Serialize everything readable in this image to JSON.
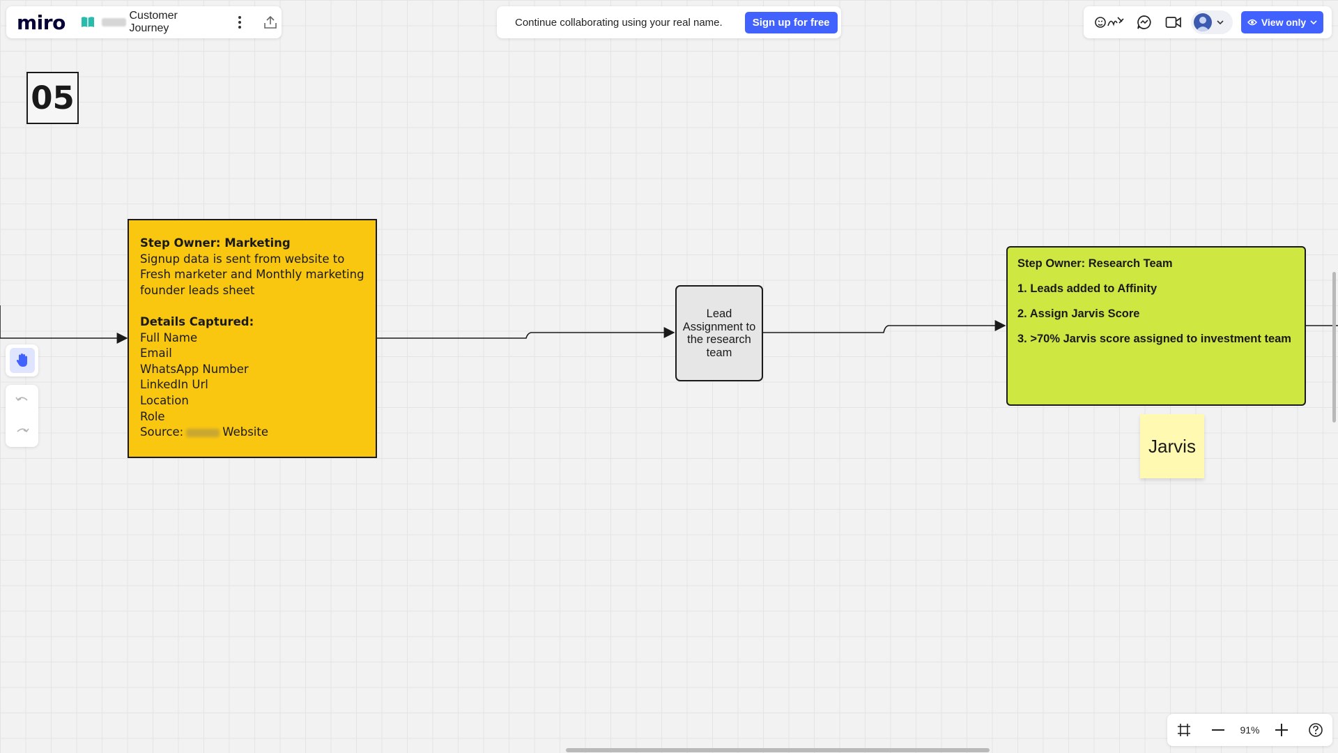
{
  "app": {
    "logo": "miro"
  },
  "board": {
    "title": "Customer Journey"
  },
  "banner": {
    "text": "Continue collaborating using your real name.",
    "signup_label": "Sign up for free"
  },
  "header_right": {
    "view_only_label": "View only"
  },
  "canvas": {
    "frame_number": "05",
    "marketing_card": {
      "owner": "Step Owner: Marketing",
      "description": "Signup data is  sent from website to Fresh marketer and Monthly marketing founder leads sheet",
      "details_heading": "Details Captured:",
      "details": [
        "Full Name",
        "Email",
        "WhatsApp Number",
        "LinkedIn Url",
        "Location",
        "Role"
      ],
      "source_prefix": "Source:",
      "source_suffix": "Website"
    },
    "lead_box": {
      "text": "Lead Assignment to the research team"
    },
    "research_card": {
      "owner": "Step Owner: Research Team",
      "items": [
        "1. Leads added to Affinity",
        "2. Assign Jarvis Score",
        "3. >70% Jarvis score assigned to investment team"
      ]
    },
    "sticky_note": {
      "text": "Jarvis"
    }
  },
  "zoom": {
    "level": "91%"
  },
  "icons": {
    "board": "book-icon",
    "more": "more-vertical-icon",
    "share": "upload-icon",
    "reactions": "reactions-icon",
    "comments": "comment-icon",
    "video": "video-icon",
    "avatar": "user-avatar-icon",
    "eye": "eye-icon",
    "hand": "hand-icon",
    "undo": "undo-icon",
    "redo": "redo-icon",
    "fit": "fit-screen-icon",
    "zoom_out": "minus-icon",
    "zoom_in": "plus-icon",
    "help": "help-icon"
  },
  "colors": {
    "accent": "#4262ff",
    "marketing_card": "#fac710",
    "research_card": "#cee741",
    "lead_box": "#e6e6e6",
    "sticky_note": "#fff9b1",
    "canvas": "#f2f2f2"
  }
}
